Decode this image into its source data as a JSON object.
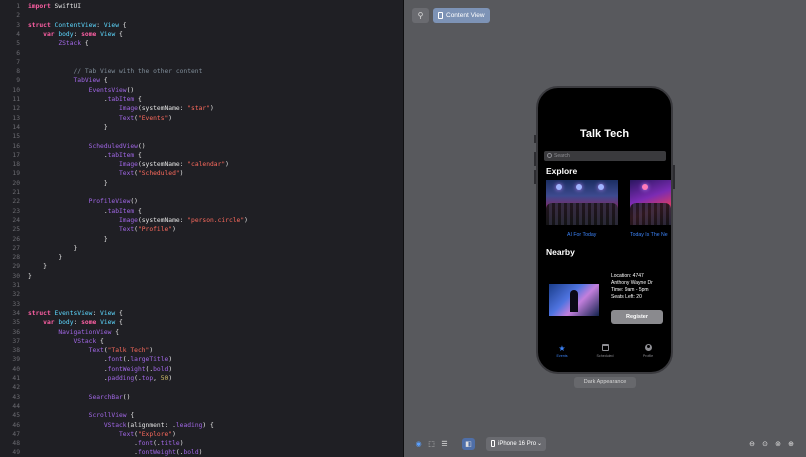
{
  "editor": {
    "lines": [
      {
        "n": "1",
        "segs": [
          {
            "t": "import",
            "c": "kw"
          },
          {
            "t": " SwiftUI",
            "c": ""
          }
        ]
      },
      {
        "n": "2",
        "segs": []
      },
      {
        "n": "3",
        "segs": [
          {
            "t": "struct",
            "c": "kw"
          },
          {
            "t": " ContentView",
            "c": "ty"
          },
          {
            "t": ": ",
            "c": ""
          },
          {
            "t": "View",
            "c": "ty"
          },
          {
            "t": " {",
            "c": ""
          }
        ]
      },
      {
        "n": "4",
        "segs": [
          {
            "t": "    var",
            "c": "kw"
          },
          {
            "t": " body",
            "c": "ty"
          },
          {
            "t": ": ",
            "c": ""
          },
          {
            "t": "some",
            "c": "kw"
          },
          {
            "t": " View",
            "c": "ty"
          },
          {
            "t": " {",
            "c": ""
          }
        ]
      },
      {
        "n": "5",
        "segs": [
          {
            "t": "        ZStack",
            "c": "fn"
          },
          {
            "t": " {",
            "c": ""
          }
        ]
      },
      {
        "n": "6",
        "segs": []
      },
      {
        "n": "7",
        "segs": []
      },
      {
        "n": "8",
        "segs": [
          {
            "t": "            // Tab View with the other content",
            "c": "cm"
          }
        ]
      },
      {
        "n": "9",
        "segs": [
          {
            "t": "            TabView",
            "c": "fn"
          },
          {
            "t": " {",
            "c": ""
          }
        ]
      },
      {
        "n": "10",
        "segs": [
          {
            "t": "                EventsView",
            "c": "fn"
          },
          {
            "t": "()",
            "c": ""
          }
        ]
      },
      {
        "n": "11",
        "segs": [
          {
            "t": "                    .",
            "c": ""
          },
          {
            "t": "tabItem",
            "c": "fn"
          },
          {
            "t": " {",
            "c": ""
          }
        ]
      },
      {
        "n": "12",
        "segs": [
          {
            "t": "                        Image",
            "c": "fn"
          },
          {
            "t": "(systemName: ",
            "c": ""
          },
          {
            "t": "\"star\"",
            "c": "st"
          },
          {
            "t": ")",
            "c": ""
          }
        ]
      },
      {
        "n": "13",
        "segs": [
          {
            "t": "                        Text",
            "c": "fn"
          },
          {
            "t": "(",
            "c": ""
          },
          {
            "t": "\"Events\"",
            "c": "st"
          },
          {
            "t": ")",
            "c": ""
          }
        ]
      },
      {
        "n": "14",
        "segs": [
          {
            "t": "                    }",
            "c": ""
          }
        ]
      },
      {
        "n": "15",
        "segs": []
      },
      {
        "n": "16",
        "segs": [
          {
            "t": "                ScheduledView",
            "c": "fn"
          },
          {
            "t": "()",
            "c": ""
          }
        ]
      },
      {
        "n": "17",
        "segs": [
          {
            "t": "                    .",
            "c": ""
          },
          {
            "t": "tabItem",
            "c": "fn"
          },
          {
            "t": " {",
            "c": ""
          }
        ]
      },
      {
        "n": "18",
        "segs": [
          {
            "t": "                        Image",
            "c": "fn"
          },
          {
            "t": "(systemName: ",
            "c": ""
          },
          {
            "t": "\"calendar\"",
            "c": "st"
          },
          {
            "t": ")",
            "c": ""
          }
        ]
      },
      {
        "n": "19",
        "segs": [
          {
            "t": "                        Text",
            "c": "fn"
          },
          {
            "t": "(",
            "c": ""
          },
          {
            "t": "\"Scheduled\"",
            "c": "st"
          },
          {
            "t": ")",
            "c": ""
          }
        ]
      },
      {
        "n": "20",
        "segs": [
          {
            "t": "                    }",
            "c": ""
          }
        ]
      },
      {
        "n": "21",
        "segs": []
      },
      {
        "n": "22",
        "segs": [
          {
            "t": "                ProfileView",
            "c": "fn"
          },
          {
            "t": "()",
            "c": ""
          }
        ]
      },
      {
        "n": "23",
        "segs": [
          {
            "t": "                    .",
            "c": ""
          },
          {
            "t": "tabItem",
            "c": "fn"
          },
          {
            "t": " {",
            "c": ""
          }
        ]
      },
      {
        "n": "24",
        "segs": [
          {
            "t": "                        Image",
            "c": "fn"
          },
          {
            "t": "(systemName: ",
            "c": ""
          },
          {
            "t": "\"person.circle\"",
            "c": "st"
          },
          {
            "t": ")",
            "c": ""
          }
        ]
      },
      {
        "n": "25",
        "segs": [
          {
            "t": "                        Text",
            "c": "fn"
          },
          {
            "t": "(",
            "c": ""
          },
          {
            "t": "\"Profile\"",
            "c": "st"
          },
          {
            "t": ")",
            "c": ""
          }
        ]
      },
      {
        "n": "26",
        "segs": [
          {
            "t": "                    }",
            "c": ""
          }
        ]
      },
      {
        "n": "27",
        "segs": [
          {
            "t": "            }",
            "c": ""
          }
        ]
      },
      {
        "n": "28",
        "segs": [
          {
            "t": "        }",
            "c": ""
          }
        ]
      },
      {
        "n": "29",
        "segs": [
          {
            "t": "    }",
            "c": ""
          }
        ]
      },
      {
        "n": "30",
        "segs": [
          {
            "t": "}",
            "c": ""
          }
        ]
      },
      {
        "n": "31",
        "segs": []
      },
      {
        "n": "32",
        "segs": []
      },
      {
        "n": "33",
        "segs": []
      },
      {
        "n": "34",
        "segs": [
          {
            "t": "struct",
            "c": "kw"
          },
          {
            "t": " EventsView",
            "c": "ty"
          },
          {
            "t": ": ",
            "c": ""
          },
          {
            "t": "View",
            "c": "ty"
          },
          {
            "t": " {",
            "c": ""
          }
        ]
      },
      {
        "n": "35",
        "segs": [
          {
            "t": "    var",
            "c": "kw"
          },
          {
            "t": " body",
            "c": "ty"
          },
          {
            "t": ": ",
            "c": ""
          },
          {
            "t": "some",
            "c": "kw"
          },
          {
            "t": " View",
            "c": "ty"
          },
          {
            "t": " {",
            "c": ""
          }
        ]
      },
      {
        "n": "36",
        "segs": [
          {
            "t": "        NavigationView",
            "c": "fn"
          },
          {
            "t": " {",
            "c": ""
          }
        ]
      },
      {
        "n": "37",
        "segs": [
          {
            "t": "            VStack",
            "c": "fn"
          },
          {
            "t": " {",
            "c": ""
          }
        ]
      },
      {
        "n": "38",
        "segs": [
          {
            "t": "                Text",
            "c": "fn"
          },
          {
            "t": "(",
            "c": ""
          },
          {
            "t": "\"Talk Tech\"",
            "c": "st"
          },
          {
            "t": ")",
            "c": ""
          }
        ]
      },
      {
        "n": "39",
        "segs": [
          {
            "t": "                    .",
            "c": ""
          },
          {
            "t": "font",
            "c": "fn"
          },
          {
            "t": "(.",
            "c": ""
          },
          {
            "t": "largeTitle",
            "c": "fn"
          },
          {
            "t": ")",
            "c": ""
          }
        ]
      },
      {
        "n": "40",
        "segs": [
          {
            "t": "                    .",
            "c": ""
          },
          {
            "t": "fontWeight",
            "c": "fn"
          },
          {
            "t": "(.",
            "c": ""
          },
          {
            "t": "bold",
            "c": "fn"
          },
          {
            "t": ")",
            "c": ""
          }
        ]
      },
      {
        "n": "41",
        "segs": [
          {
            "t": "                    .",
            "c": ""
          },
          {
            "t": "padding",
            "c": "fn"
          },
          {
            "t": "(.",
            "c": ""
          },
          {
            "t": "top",
            "c": "fn"
          },
          {
            "t": ", ",
            "c": ""
          },
          {
            "t": "50",
            "c": "nm"
          },
          {
            "t": ")",
            "c": ""
          }
        ]
      },
      {
        "n": "42",
        "segs": []
      },
      {
        "n": "43",
        "segs": [
          {
            "t": "                SearchBar",
            "c": "fn"
          },
          {
            "t": "()",
            "c": ""
          }
        ]
      },
      {
        "n": "44",
        "segs": []
      },
      {
        "n": "45",
        "segs": [
          {
            "t": "                ScrollView",
            "c": "fn"
          },
          {
            "t": " {",
            "c": ""
          }
        ]
      },
      {
        "n": "46",
        "segs": [
          {
            "t": "                    VStack",
            "c": "fn"
          },
          {
            "t": "(alignment: .",
            "c": ""
          },
          {
            "t": "leading",
            "c": "fn"
          },
          {
            "t": ") {",
            "c": ""
          }
        ]
      },
      {
        "n": "47",
        "segs": [
          {
            "t": "                        Text",
            "c": "fn"
          },
          {
            "t": "(",
            "c": ""
          },
          {
            "t": "\"Explore\"",
            "c": "st"
          },
          {
            "t": ")",
            "c": ""
          }
        ]
      },
      {
        "n": "48",
        "segs": [
          {
            "t": "                            .",
            "c": ""
          },
          {
            "t": "font",
            "c": "fn"
          },
          {
            "t": "(.",
            "c": ""
          },
          {
            "t": "title",
            "c": "fn"
          },
          {
            "t": ")",
            "c": ""
          }
        ]
      },
      {
        "n": "49",
        "segs": [
          {
            "t": "                            .",
            "c": ""
          },
          {
            "t": "fontWeight",
            "c": "fn"
          },
          {
            "t": "(.",
            "c": ""
          },
          {
            "t": "bold",
            "c": "fn"
          },
          {
            "t": ")",
            "c": ""
          }
        ]
      }
    ]
  },
  "canvas": {
    "pin_icon": "pin-icon",
    "tab_label": "Content View",
    "appearance_label": "Dark Appearance",
    "device_label": "iPhone 16 Pro"
  },
  "app": {
    "title": "Talk Tech",
    "search_placeholder": "Search",
    "explore_title": "Explore",
    "cards": [
      {
        "caption": "AI For Today"
      },
      {
        "caption": "Today Is The Ne"
      }
    ],
    "nearby_title": "Nearby",
    "nearby": {
      "location": "Location: 4747",
      "address": "Anthony Wayne Dr",
      "time": "Time: 9am - 5pm",
      "seats": "Seats Left: 20",
      "register_label": "Register"
    },
    "tabs": [
      {
        "label": "Events",
        "icon": "star-icon"
      },
      {
        "label": "Scheduled",
        "icon": "calendar-icon"
      },
      {
        "label": "Profile",
        "icon": "person-circle-icon"
      }
    ]
  },
  "colors": {
    "accent": "#3b82f6",
    "keyword": "#fc5fa3",
    "string": "#fc6a5d"
  }
}
